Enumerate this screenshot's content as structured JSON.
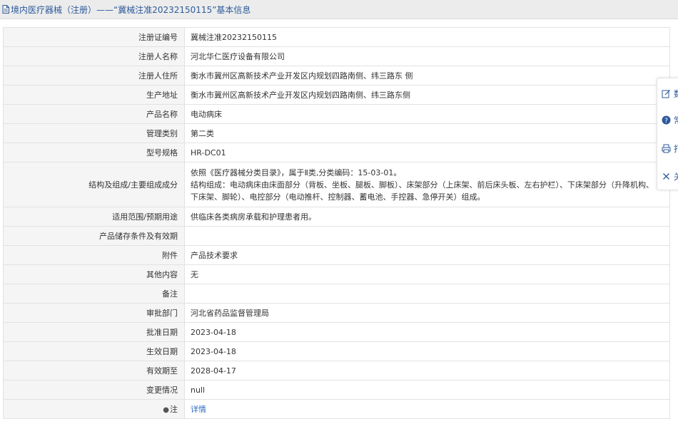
{
  "header": {
    "title": "境内医疗器械（注册）——“冀械注准20232150115”基本信息"
  },
  "fields": [
    {
      "label": "注册证编号",
      "value": "冀械注准20232150115"
    },
    {
      "label": "注册人名称",
      "value": "河北华仁医疗设备有限公司"
    },
    {
      "label": "注册人住所",
      "value": "衡水市冀州区高新技术产业开发区内规划四路南侧、纬三路东 侧"
    },
    {
      "label": "生产地址",
      "value": "衡水市冀州区高新技术产业开发区内规划四路南侧、纬三路东侧"
    },
    {
      "label": "产品名称",
      "value": "电动病床"
    },
    {
      "label": "管理类别",
      "value": "第二类"
    },
    {
      "label": "型号规格",
      "value": "HR-DC01"
    },
    {
      "label": "结构及组成/主要组成成分",
      "value": "依照《医疗器械分类目录》，属于Ⅱ类,分类编码：15-03-01。",
      "value2": "结构组成：电动病床由床面部分（背板、坐板、腿板、脚板）、床架部分（上床架、前后床头板、左右护栏）、下床架部分（升降机构、下床架、脚轮）、电控部分（电动推杆、控制器、蓄电池、手控器、急停开关）组成。"
    },
    {
      "label": "适用范围/预期用途",
      "value": "供临床各类病房承载和护理患者用。"
    },
    {
      "label": "产品储存条件及有效期",
      "value": ""
    },
    {
      "label": "附件",
      "value": "产品技术要求"
    },
    {
      "label": "其他内容",
      "value": "无"
    },
    {
      "label": "备注",
      "value": ""
    },
    {
      "label": "审批部门",
      "value": "河北省药品监督管理局"
    },
    {
      "label": "批准日期",
      "value": "2023-04-18"
    },
    {
      "label": "生效日期",
      "value": "2023-04-18"
    },
    {
      "label": "有效期至",
      "value": "2028-04-17"
    },
    {
      "label": "变更情况",
      "value": "null"
    },
    {
      "label": "注",
      "value": "详情"
    }
  ],
  "float_panel": [
    {
      "label": "数",
      "icon": "edit-icon"
    },
    {
      "label": "常",
      "icon": "help-icon"
    },
    {
      "label": "打",
      "icon": "print-icon"
    },
    {
      "label": "关",
      "icon": "close-icon"
    }
  ],
  "colors": {
    "title": "#2d5a9a",
    "link": "#2b6bc4",
    "label_bg": "#f5f5f5",
    "border": "#e2e2e2"
  }
}
